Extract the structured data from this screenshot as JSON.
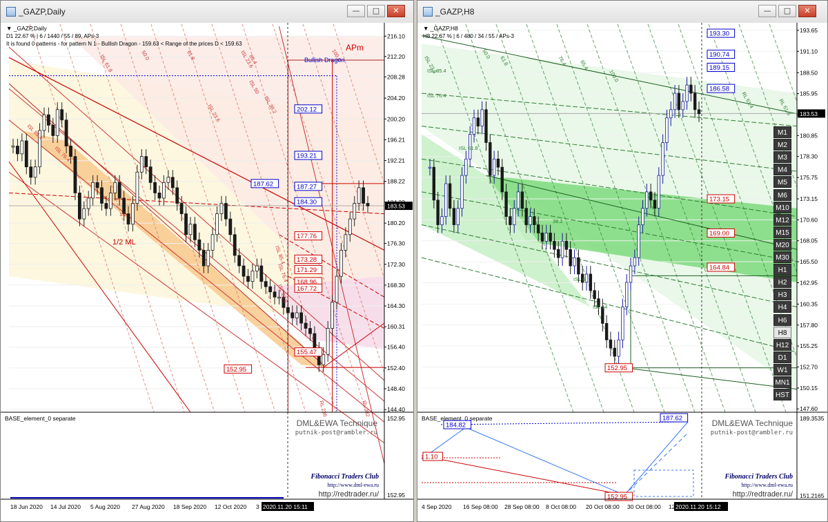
{
  "left_window": {
    "title": "_GAZP,Daily",
    "buttons": {
      "minimize": "—",
      "maximize": "□",
      "close": "✕"
    },
    "info_line1": "D1  22.67 %  |  6 / 1440 / 55 / 89, APs-3",
    "info_line2": "It is found 0 patterns  -  for pattern N 1 - Bullish Dragon  - 159.63 < Range of the prices D < 159.63",
    "symbol_menu": "▼  _GAZP,Daily",
    "pattern_name": "Bullish Dragon",
    "apm_label": "APm",
    "half_line_label": "1/2 ML",
    "indicator_title": "BASE_element_0 separate",
    "watermark1": "DML&EWA Technique",
    "watermark2": "putnik-post@rambler.ru",
    "club": "Fibonacci Traders Club",
    "url1": "http://www.dml-ewa.ru",
    "url2": "http://redtrader.ru/",
    "current_price": "183.53",
    "low_label": "152.95",
    "high_label": "187.62",
    "price_boxes_blue": [
      "202.12",
      "193.21",
      "187.27",
      "184.30"
    ],
    "price_boxes_red": [
      "177.76",
      "173.28",
      "171.29",
      "168.96",
      "167.72",
      "155.47"
    ],
    "indicator_axis": [
      "152.95",
      "152.95"
    ],
    "time_cursor": "2020.11.20 15:11",
    "time_tail": "3",
    "fib_labels": [
      "ISL 85.4",
      "ISL 76.4",
      "1/2",
      "50.0",
      "61.8",
      "ISL 61.8",
      "85.4",
      "ISL 50",
      "ISL 38.2",
      "ISL 23.6",
      "ISL 85.4",
      "ISL 76.4",
      "ISL 23.6",
      "RL 236",
      "RL 382",
      "100.0",
      "ISL 23.6"
    ]
  },
  "right_window": {
    "title": "_GAZP,H8",
    "buttons": {
      "minimize": "—",
      "maximize": "□",
      "close": "✕"
    },
    "info_line1": "H8  22.67 %  |  6 / 480 / 34 / 55 / APs-3",
    "symbol_menu": "▼  _GAZP,H8",
    "indicator_title": "BASE_element_0 separate",
    "watermark1": "DML&EWA Technique",
    "watermark2": "putnik-post@rambler.ru",
    "club": "Fibonacci Traders Club",
    "url1": "http://www.dml-ewa.ru",
    "url2": "http://redtrader.ru/",
    "current_price": "183.53",
    "low_label": "152.95",
    "price_boxes_blue": [
      "193.30",
      "190.74",
      "189.15",
      "186.58"
    ],
    "price_boxes_red": [
      "173.15",
      "169.00",
      "164.84"
    ],
    "ind_box_184": "184.82",
    "ind_box_187": "187.62",
    "ind_box_110": "1.10",
    "ind_box_152": "152.95",
    "ind_axis": [
      "189.3535",
      "151.2165"
    ],
    "time_cursor": "2020.11.20 15:12",
    "time_tail": "12",
    "timeframes": [
      "M1",
      "M2",
      "M3",
      "M4",
      "M5",
      "M6",
      "M10",
      "M12",
      "M15",
      "M20",
      "M30",
      "H1",
      "H2",
      "H3",
      "H4",
      "H6",
      "H8",
      "H12",
      "D1",
      "W1",
      "MN1",
      "HST"
    ],
    "active_timeframe": "H8",
    "fib_labels": [
      "ISL 23.6",
      "50.0",
      "61.8",
      "ISL 85.4",
      "ISL 76.4",
      "ISL 61.8",
      "76.4",
      "85.4",
      "100.0",
      "RL 61.4",
      "RL 61.8",
      "ISL 14",
      "38.2",
      "ISL 6"
    ]
  },
  "chart_data": [
    {
      "type": "line",
      "title": "_GAZP,Daily",
      "x_ticks": [
        "18 Jun 2020",
        "14 Jul 2020",
        "5 Aug 2020",
        "27 Aug 2020",
        "18 Sep 2020",
        "12 Oct 2020"
      ],
      "y_ticks": [
        216.1,
        212.2,
        208.28,
        204.2,
        200.2,
        196.21,
        192.21,
        188.22,
        184.22,
        180.2,
        176.3,
        172.3,
        168.3,
        164.3,
        160.31,
        156.4,
        152.4,
        148.4,
        144.4
      ],
      "ylim": [
        143.9,
        218.4
      ],
      "series": [
        {
          "values": [
            195,
            193.5,
            196,
            191,
            189,
            191,
            198,
            201,
            199,
            197,
            202,
            200,
            195,
            193,
            186,
            181,
            183,
            185,
            188,
            187,
            184,
            183,
            186,
            188,
            185,
            182,
            180,
            184,
            190,
            193,
            191,
            188,
            186,
            185,
            188,
            189,
            187,
            184,
            182,
            178,
            180,
            177,
            175,
            172,
            175,
            178,
            182,
            184,
            181,
            178,
            174,
            172,
            170,
            169,
            171,
            172,
            169,
            168,
            167,
            166,
            166,
            164,
            163,
            162,
            163,
            161,
            160,
            159,
            156,
            153,
            155,
            160,
            165,
            170,
            175,
            178,
            181,
            184,
            187,
            184,
            183.5
          ]
        }
      ],
      "current_price": 183.53,
      "levels_blue": [
        202.12,
        193.21,
        187.27,
        184.3
      ],
      "levels_red": [
        177.76,
        173.28,
        171.29,
        168.96,
        167.72,
        155.47
      ],
      "low": 152.95,
      "high": 187.62
    },
    {
      "type": "line",
      "title": "_GAZP,H8",
      "x_ticks": [
        "4 Sep 2020",
        "16 Sep 08:00",
        "28 Sep 08:00",
        "8 Oct 08:00",
        "20 Oct 08:00",
        "30 Oct 08:00"
      ],
      "y_ticks": [
        193.65,
        191.1,
        188.5,
        185.95,
        183.4,
        180.85,
        178.3,
        175.75,
        173.15,
        170.6,
        168.05,
        165.5,
        162.95,
        160.35,
        157.8,
        155.25,
        152.7,
        150.15,
        147.6
      ],
      "ylim": [
        147.2,
        194.4
      ],
      "series": [
        {
          "values": [
            177,
            173,
            170,
            171,
            175,
            172,
            170,
            172,
            176,
            178,
            181,
            183,
            182,
            184,
            180,
            176,
            178,
            177,
            174,
            171,
            170,
            172,
            174,
            172,
            170,
            171,
            170,
            169,
            168,
            169,
            168,
            167,
            166,
            168,
            167,
            165,
            166,
            164,
            163,
            164,
            162,
            161,
            160,
            158,
            156,
            155,
            154,
            156,
            160,
            163,
            165,
            166,
            170,
            172,
            174,
            173,
            172,
            176,
            180,
            183,
            184,
            186,
            184,
            185,
            187,
            186,
            184,
            183.5
          ]
        }
      ],
      "current_price": 183.53,
      "levels_blue": [
        193.3,
        190.74,
        189.15,
        186.58
      ],
      "levels_red": [
        173.15,
        169.0,
        164.84
      ],
      "low": 152.95
    }
  ]
}
